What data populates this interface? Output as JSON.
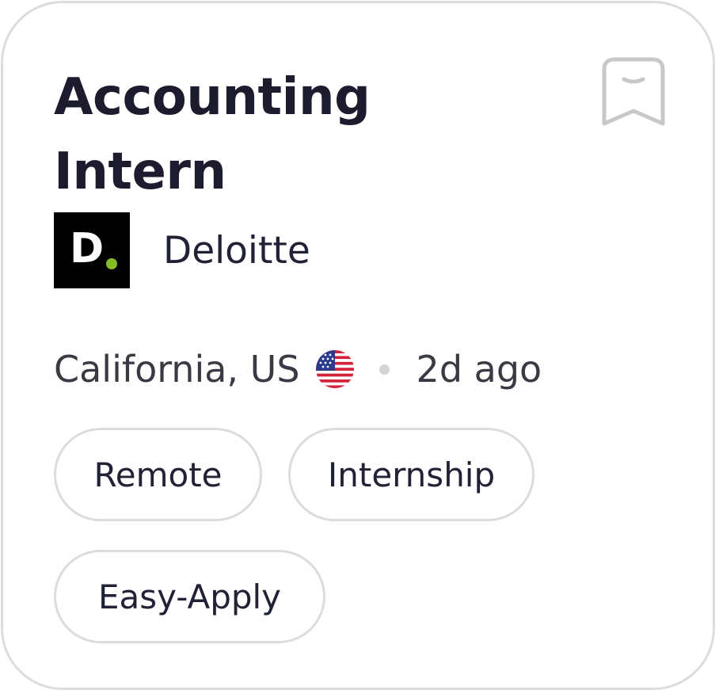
{
  "job": {
    "title": "Accounting Intern",
    "company": {
      "name": "Deloitte",
      "logo_letter": "D"
    },
    "location": "California, US",
    "posted": "2d ago",
    "tags": [
      "Remote",
      "Internship",
      "Easy-Apply"
    ]
  },
  "icons": {
    "bookmark": "bookmark-icon",
    "flag": "us-flag-icon",
    "company_logo": "deloitte-logo"
  },
  "colors": {
    "title_text": "#1c1c2e",
    "border": "#dcdcdc",
    "logo_background": "#000000",
    "logo_dot": "#86bc25",
    "separator_dot": "#d4d4d4",
    "bookmark_stroke": "#c8c8c8"
  }
}
